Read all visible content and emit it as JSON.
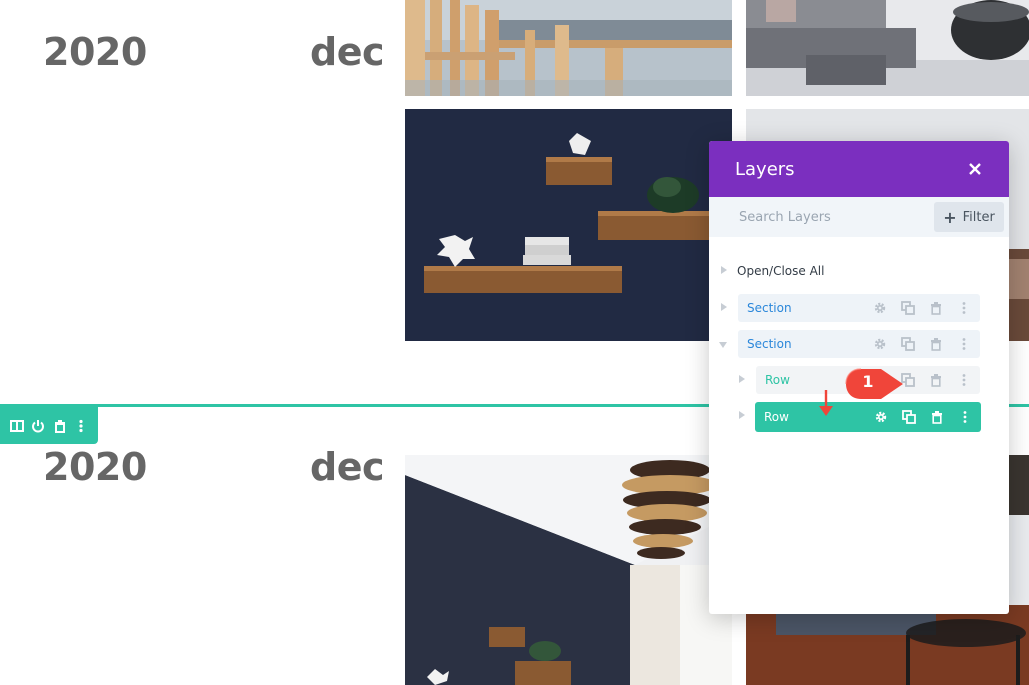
{
  "posts": [
    {
      "year": "2020",
      "month": "dec"
    },
    {
      "year": "2020",
      "month": "dec"
    }
  ],
  "layers": {
    "title": "Layers",
    "search_placeholder": "Search Layers",
    "filter_label": "Filter",
    "open_close_label": "Open/Close All",
    "items": [
      {
        "type": "section",
        "label": "Section",
        "expanded": false
      },
      {
        "type": "section",
        "label": "Section",
        "expanded": true
      },
      {
        "type": "row",
        "label": "Row",
        "active": false
      },
      {
        "type": "row",
        "label": "Row",
        "active": true
      }
    ]
  },
  "annotation": {
    "badge": "1",
    "color": "#f0453a"
  },
  "colors": {
    "accent_purple": "#7b2fbf",
    "row_green": "#2ec4a5",
    "section_blue": "#2b87da",
    "date_text": "#666666"
  },
  "icons": {
    "toolbar": [
      "columns-icon",
      "power-icon",
      "trash-icon",
      "more-icon"
    ],
    "layer_actions": [
      "gear-icon",
      "duplicate-icon",
      "trash-icon",
      "more-icon"
    ]
  }
}
